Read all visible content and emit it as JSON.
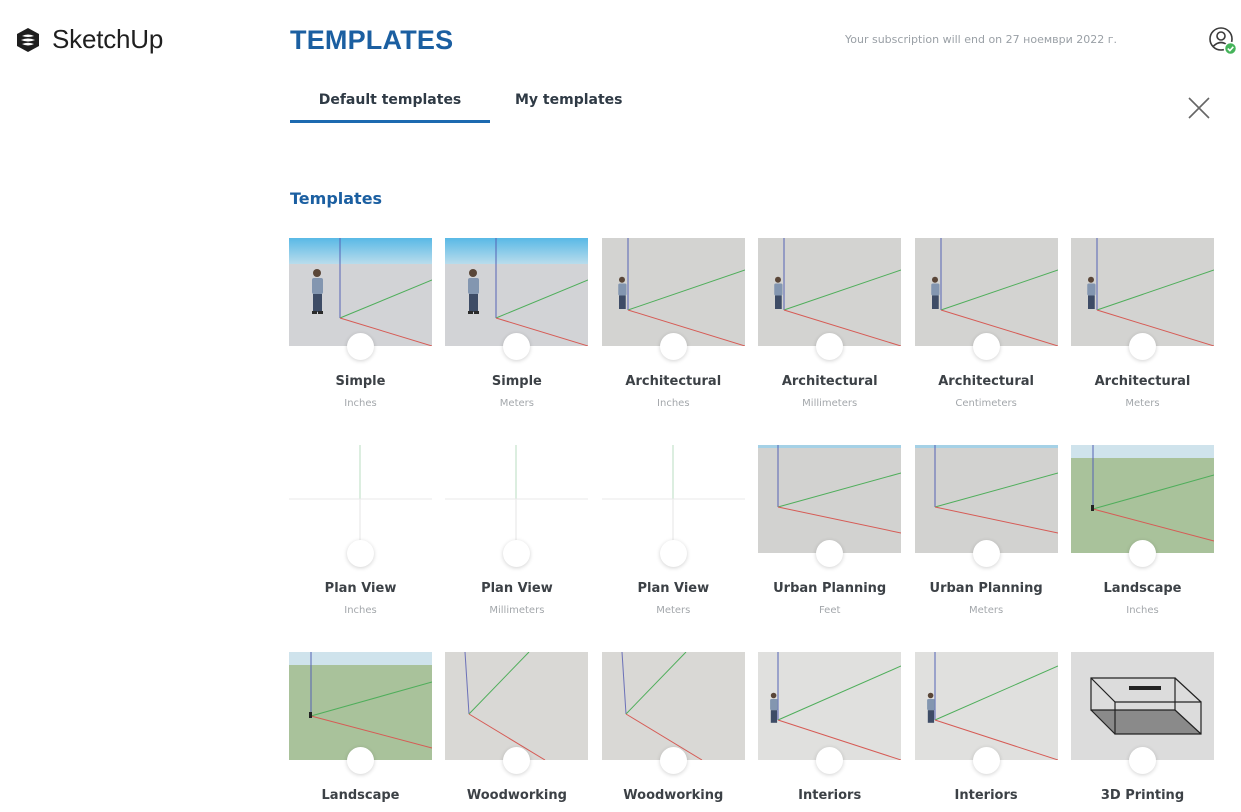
{
  "header": {
    "app_name": "SketchUp",
    "page_title": "TEMPLATES",
    "subscription_text": "Your subscription will end on 27 ноември 2022 г."
  },
  "tabs": [
    {
      "label": "Default templates",
      "active": true
    },
    {
      "label": "My templates",
      "active": false
    }
  ],
  "section_title": "Templates",
  "templates": [
    {
      "title": "Simple",
      "unit": "Inches",
      "thumb": "simple"
    },
    {
      "title": "Simple",
      "unit": "Meters",
      "thumb": "simple"
    },
    {
      "title": "Architectural",
      "unit": "Inches",
      "thumb": "architectural"
    },
    {
      "title": "Architectural",
      "unit": "Millimeters",
      "thumb": "architectural"
    },
    {
      "title": "Architectural",
      "unit": "Centimeters",
      "thumb": "architectural"
    },
    {
      "title": "Architectural",
      "unit": "Meters",
      "thumb": "architectural"
    },
    {
      "title": "Plan View",
      "unit": "Inches",
      "thumb": "plan"
    },
    {
      "title": "Plan View",
      "unit": "Millimeters",
      "thumb": "plan"
    },
    {
      "title": "Plan View",
      "unit": "Meters",
      "thumb": "plan"
    },
    {
      "title": "Urban Planning",
      "unit": "Feet",
      "thumb": "urban"
    },
    {
      "title": "Urban Planning",
      "unit": "Meters",
      "thumb": "urban"
    },
    {
      "title": "Landscape",
      "unit": "Inches",
      "thumb": "landscape"
    },
    {
      "title": "Landscape",
      "unit": "",
      "thumb": "landscape"
    },
    {
      "title": "Woodworking",
      "unit": "",
      "thumb": "woodworking"
    },
    {
      "title": "Woodworking",
      "unit": "",
      "thumb": "woodworking"
    },
    {
      "title": "Interiors",
      "unit": "",
      "thumb": "interiors"
    },
    {
      "title": "Interiors",
      "unit": "",
      "thumb": "interiors"
    },
    {
      "title": "3D Printing",
      "unit": "",
      "thumb": "printing"
    }
  ],
  "icons": {
    "logo": "sketchup-logo-icon",
    "account": "user-account-icon",
    "close": "close-icon"
  },
  "colors": {
    "accent": "#1b5fa1",
    "tab_underline": "#1c6ab0",
    "status_green": "#45b35a"
  }
}
